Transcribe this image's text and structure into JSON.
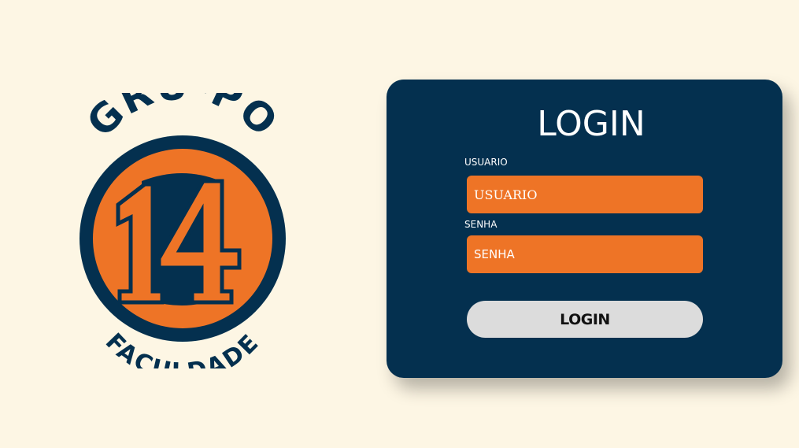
{
  "logo": {
    "top_text": "GRU-PO",
    "number": "14",
    "bottom_text": "FACULDADE"
  },
  "login_card": {
    "title": "LOGIN",
    "username_label": "USUARIO",
    "username_placeholder": "USUARIO",
    "password_label": "SENHA",
    "password_placeholder": "SENHA",
    "submit_label": "LOGIN"
  },
  "colors": {
    "background": "#fdf6e4",
    "navy": "#04304f",
    "orange": "#ee7426",
    "button": "#dcdcdc"
  }
}
